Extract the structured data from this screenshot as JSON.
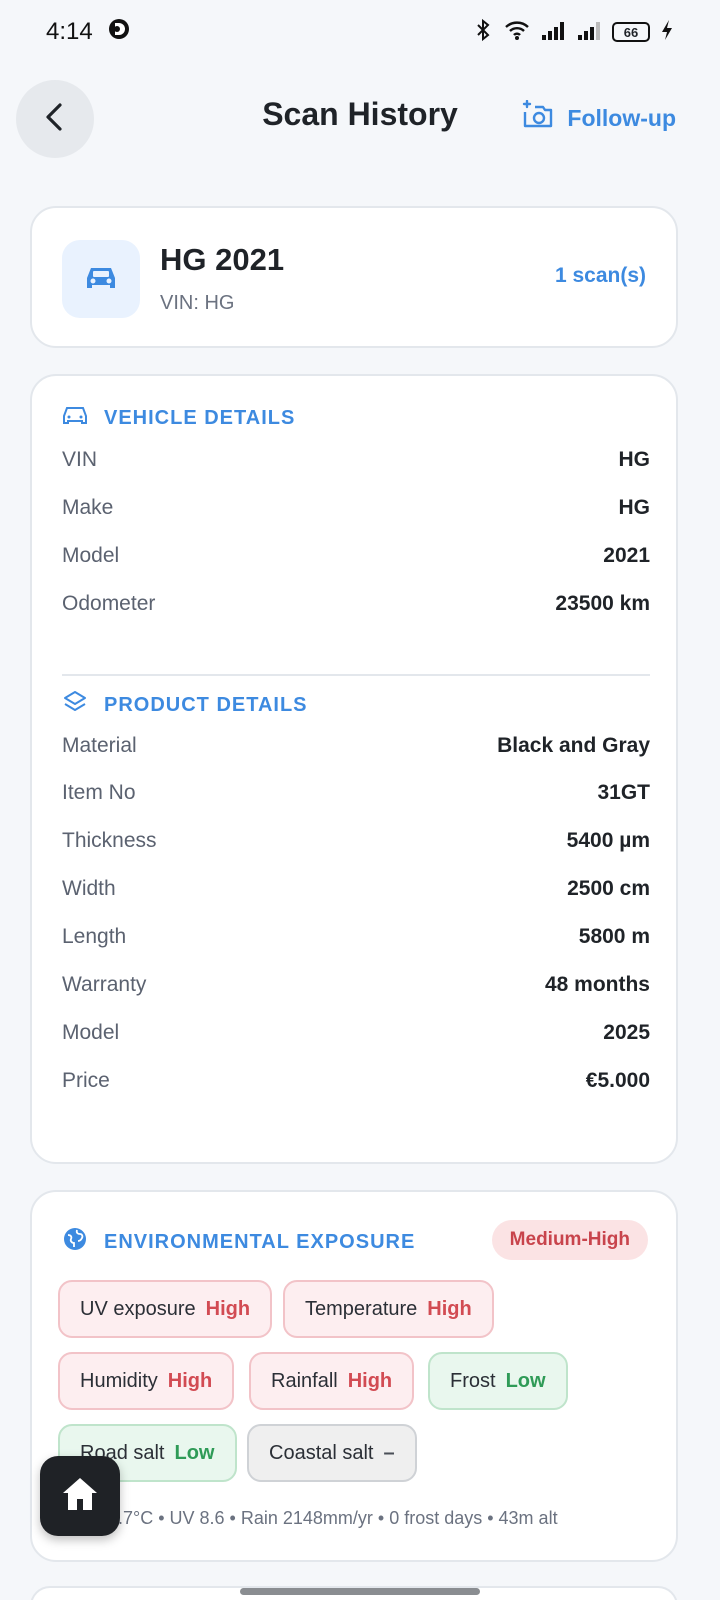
{
  "status": {
    "time": "4:14",
    "battery": "66"
  },
  "header": {
    "title": "Scan History",
    "followup_label": "Follow-up"
  },
  "vehicle_card": {
    "title": "HG 2021",
    "vin_line": "VIN: HG",
    "scan_count": "1 scan(s)"
  },
  "vehicle_details": {
    "heading": "VEHICLE DETAILS",
    "rows": [
      {
        "label": "VIN",
        "value": "HG"
      },
      {
        "label": "Make",
        "value": "HG"
      },
      {
        "label": "Model",
        "value": "2021"
      },
      {
        "label": "Odometer",
        "value": "23500 km"
      }
    ]
  },
  "product_details": {
    "heading": "PRODUCT DETAILS",
    "rows": [
      {
        "label": "Material",
        "value": "Black and Gray"
      },
      {
        "label": "Item No",
        "value": "31GT"
      },
      {
        "label": "Thickness",
        "value": "5400 µm"
      },
      {
        "label": "Width",
        "value": "2500 cm"
      },
      {
        "label": "Length",
        "value": "5800 m"
      },
      {
        "label": "Warranty",
        "value": "48 months"
      },
      {
        "label": "Model",
        "value": "2025"
      },
      {
        "label": "Price",
        "value": "€5.000"
      }
    ]
  },
  "environment": {
    "heading": "ENVIRONMENTAL EXPOSURE",
    "level": "Medium-High",
    "chips": [
      {
        "label": "UV exposure",
        "value": "High"
      },
      {
        "label": "Temperature",
        "value": "High"
      },
      {
        "label": "Humidity",
        "value": "High"
      },
      {
        "label": "Rainfall",
        "value": "High"
      },
      {
        "label": "Frost",
        "value": "Low"
      },
      {
        "label": "Road salt",
        "value": "Low"
      },
      {
        "label": "Coastal salt",
        "value": "–"
      }
    ],
    "footer": ".7°C  •  UV 8.6  •  Rain 2148mm/yr  •  0 frost days  •  43m alt"
  },
  "colors": {
    "accent": "#3d8ae0",
    "high": "#d24b53",
    "low": "#2f9b57"
  }
}
